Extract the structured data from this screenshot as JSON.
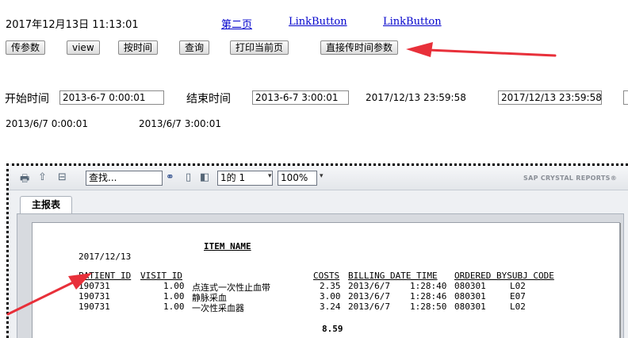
{
  "header": {
    "datetime": "2017年12月13日  11:13:01",
    "links": [
      "第二页",
      "LinkButton",
      "LinkButton"
    ]
  },
  "buttons": {
    "pass_params": "传参数",
    "view": "view",
    "by_time": "按时间",
    "query": "查询",
    "print_page": "打印当前页",
    "direct_time_params": "直接传时间参数"
  },
  "filters": {
    "start_label": "开始时间",
    "start_value": "2013-6-7 0:00:01",
    "end_label": "结束时间",
    "end_value": "2013-6-7 3:00:01",
    "current_text": "2017/12/13 23:59:58",
    "current_value": "2017/12/13 23:59:58"
  },
  "echo": {
    "start": "2013/6/7 0:00:01",
    "end": "2013/6/7 3:00:01"
  },
  "viewer": {
    "search_placeholder": "查找...",
    "page_indicator": "1的 1",
    "zoom": "100%",
    "brand": "SAP CRYSTAL REPORTS®",
    "tab": "主报表",
    "icons": [
      "print-icon",
      "export-icon",
      "group-tree-icon",
      "binoculars-icon",
      "first-page-icon",
      "prev-page-icon"
    ]
  },
  "report": {
    "title": "ITEM NAME",
    "date": "2017/12/13",
    "columns": [
      "PATIENT ID",
      "VISIT ID",
      "COSTS",
      "BILLING DATE TIME",
      "ORDERED BYSUBJ CODE"
    ],
    "rows": [
      {
        "patient_id": "190731",
        "visit_id": "1.00",
        "item": "点连式一次性止血带",
        "costs": "2.35",
        "date": "2013/6/7",
        "time": "1:28:40",
        "ordered": "080301",
        "code": "L02"
      },
      {
        "patient_id": "190731",
        "visit_id": "1.00",
        "item": "静脉采血",
        "costs": "3.00",
        "date": "2013/6/7",
        "time": "1:28:46",
        "ordered": "080301",
        "code": "E07"
      },
      {
        "patient_id": "190731",
        "visit_id": "1.00",
        "item": "一次性采血器",
        "costs": "3.24",
        "date": "2013/6/7",
        "time": "1:28:50",
        "ordered": "080301",
        "code": "L02"
      }
    ],
    "total": "8.59"
  },
  "colors": {
    "annotation_arrow": "#e8303a",
    "link": "#0000cc"
  }
}
